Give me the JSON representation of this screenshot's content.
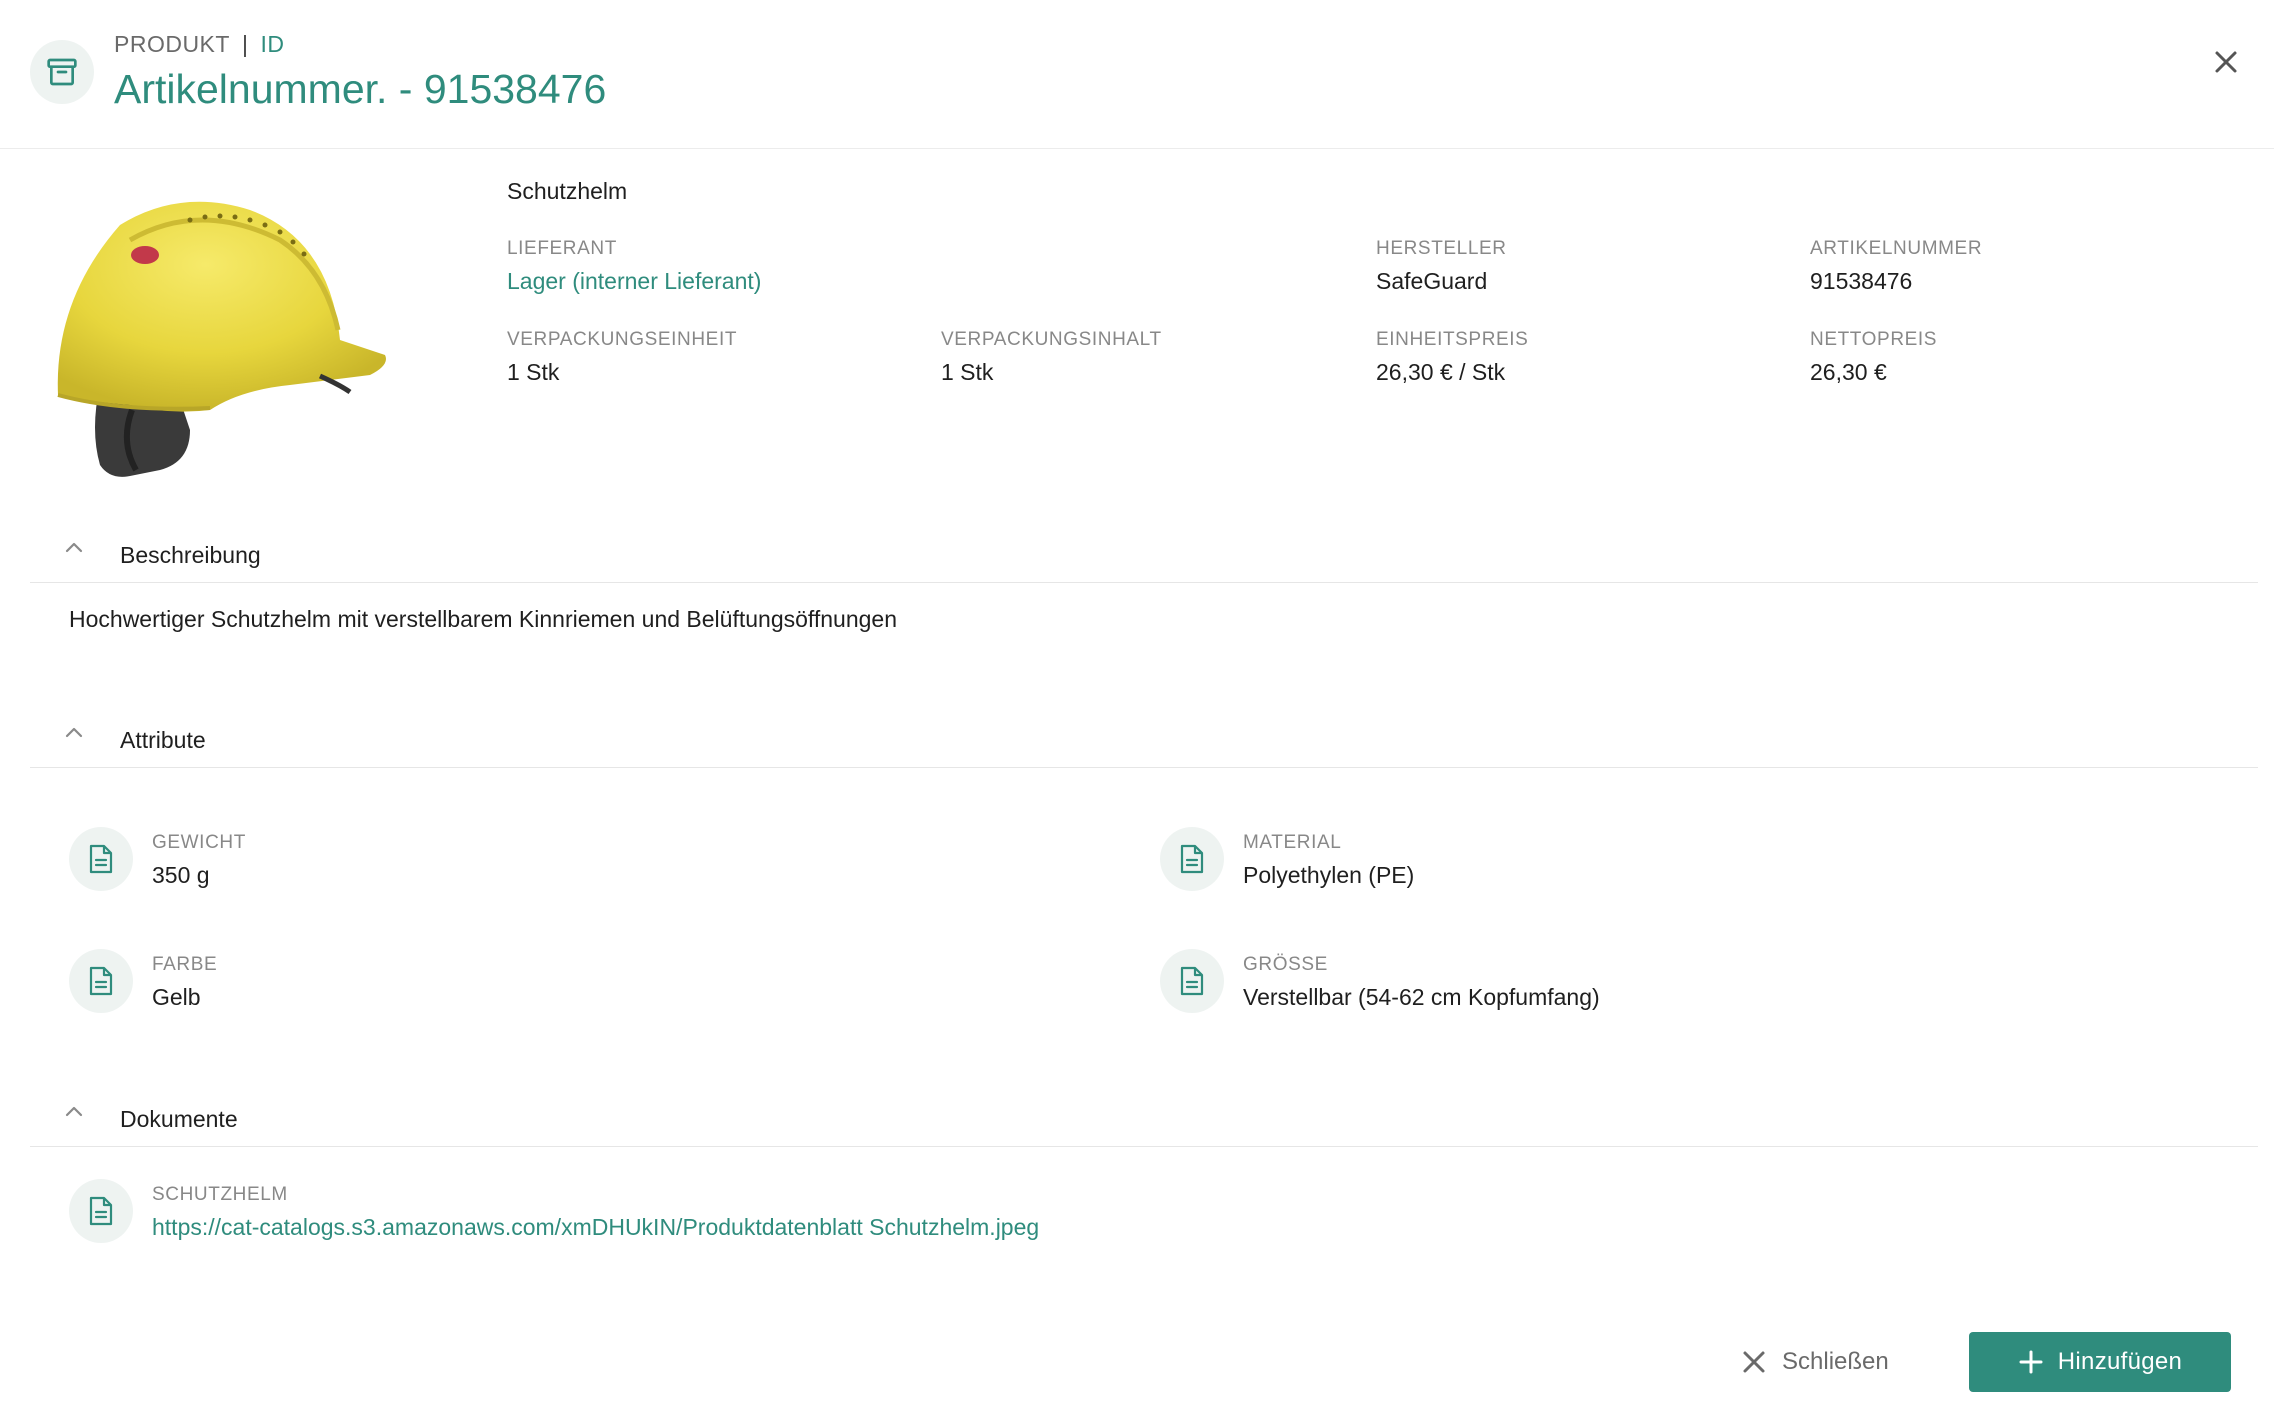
{
  "header": {
    "breadcrumb_section": "PRODUKT",
    "breadcrumb_separator": "|",
    "breadcrumb_id": "ID",
    "title": "Artikelnummer. - 91538476",
    "header_icon": "archive-box-icon",
    "close_icon": "close-icon"
  },
  "product": {
    "name": "Schutzhelm",
    "image": "yellow-safety-helmet",
    "fields": {
      "lieferant": {
        "label": "LIEFERANT",
        "value": "Lager (interner Lieferant)"
      },
      "hersteller": {
        "label": "HERSTELLER",
        "value": "SafeGuard"
      },
      "artikelnummer": {
        "label": "ARTIKELNUMMER",
        "value": "91538476"
      },
      "verpackungseinheit": {
        "label": "VERPACKUNGSEINHEIT",
        "value": "1 Stk"
      },
      "verpackungsinhalt": {
        "label": "VERPACKUNGSINHALT",
        "value": "1 Stk"
      },
      "einheitspreis": {
        "label": "EINHEITSPREIS",
        "value": "26,30 € / Stk"
      },
      "nettopreis": {
        "label": "NETTOPREIS",
        "value": "26,30 €"
      }
    }
  },
  "sections": {
    "beschreibung": {
      "title": "Beschreibung",
      "text": "Hochwertiger Schutzhelm mit verstellbarem Kinnriemen und Belüftungsöffnungen"
    },
    "attribute": {
      "title": "Attribute",
      "items": [
        {
          "label": "GEWICHT",
          "value": "350 g",
          "icon": "document-icon"
        },
        {
          "label": "MATERIAL",
          "value": "Polyethylen (PE)",
          "icon": "document-icon"
        },
        {
          "label": "FARBE",
          "value": "Gelb",
          "icon": "document-icon"
        },
        {
          "label": "GRÖSSE",
          "value": "Verstellbar (54-62 cm Kopfumfang)",
          "icon": "document-icon"
        }
      ]
    },
    "dokumente": {
      "title": "Dokumente",
      "items": [
        {
          "label": "SCHUTZHELM",
          "value": "https://cat-catalogs.s3.amazonaws.com/xmDHUkIN/Produktdatenblatt Schutzhelm.jpeg",
          "icon": "document-icon"
        }
      ]
    }
  },
  "footer": {
    "close_label": "Schließen",
    "add_label": "Hinzufügen"
  },
  "colors": {
    "accent": "#2f8c7d",
    "icon_background": "#eef3f1",
    "label_gray": "#888888"
  }
}
